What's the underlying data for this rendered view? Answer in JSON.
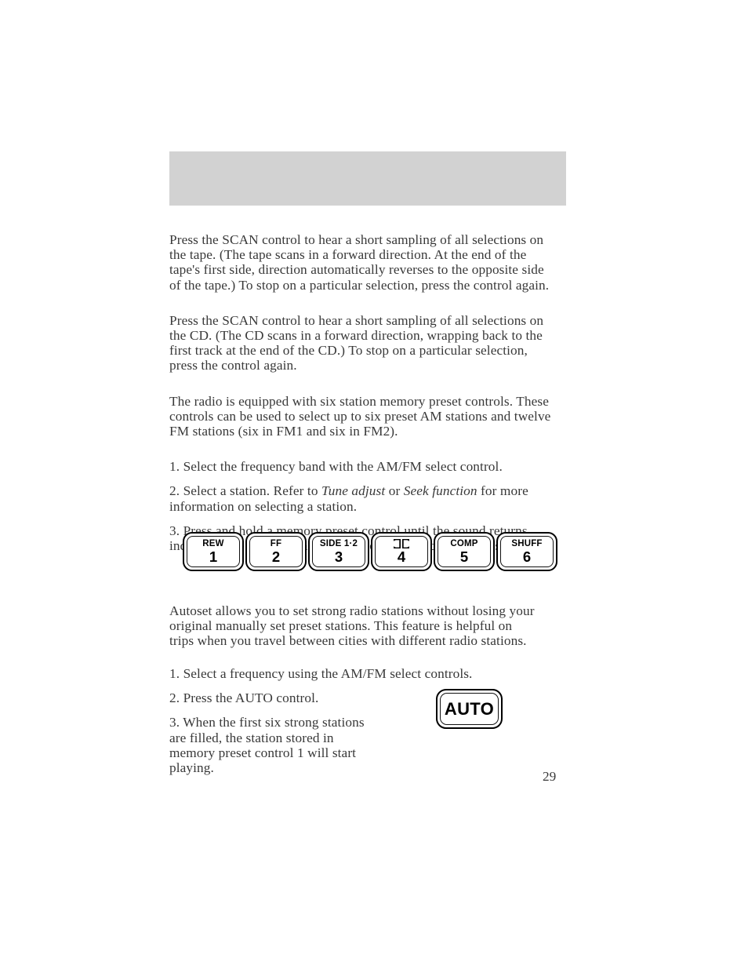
{
  "page": {
    "number": "29",
    "header_band": {
      "label": "",
      "background": "#d2d2d2"
    }
  },
  "content": {
    "scan_tape_paragraph": "Press the SCAN control to hear a short sampling of all selections on the tape. (The tape scans in a forward direction. At the end of the tape's first side, direction automatically reverses to the opposite side of the tape.) To stop on a particular selection, press the control again.",
    "scan_cd_paragraph": "Press the SCAN control to hear a short sampling of all selections on the CD. (The CD scans in a forward direction, wrapping back to the first track at the end of the CD.) To stop on a particular selection, press the control again.",
    "memory_preset_paragraph": "The radio is equipped with six station memory preset controls. These controls can be used to select up to six preset AM stations and twelve FM stations (six in FM1 and six in FM2).",
    "preset_steps": {
      "step1": "1. Select the frequency band with the AM/FM select control.",
      "step2_a": "2. Select a station. Refer to ",
      "step2_italic1": "Tune adjust",
      "step2_b": " or ",
      "step2_italic2": "Seek function",
      "step2_c": " for more information on selecting a station.",
      "step3": "3. Press and hold a memory preset control until the sound returns, indicating the station is held in memory on the control you selected."
    },
    "autoset_paragraph": "Autoset allows you to set strong radio stations without losing your original manually set preset stations. This feature is helpful on trips when you travel between cities with different radio stations.",
    "autoset_steps": {
      "step1": "1. Select a frequency using the AM/FM select controls.",
      "step2": "2. Press the AUTO control.",
      "step3": "3. When the first six strong stations are filled, the station stored in memory preset control 1 will start playing."
    }
  },
  "preset_buttons": [
    {
      "function_label": "REW",
      "number": "1",
      "icon": ""
    },
    {
      "function_label": "FF",
      "number": "2",
      "icon": ""
    },
    {
      "function_label": "SIDE 1·2",
      "number": "3",
      "icon": ""
    },
    {
      "function_label": "",
      "number": "4",
      "icon": "dolby-double-d-icon"
    },
    {
      "function_label": "COMP",
      "number": "5",
      "icon": ""
    },
    {
      "function_label": "SHUFF",
      "number": "6",
      "icon": ""
    }
  ],
  "auto_button": {
    "label": "AUTO"
  }
}
